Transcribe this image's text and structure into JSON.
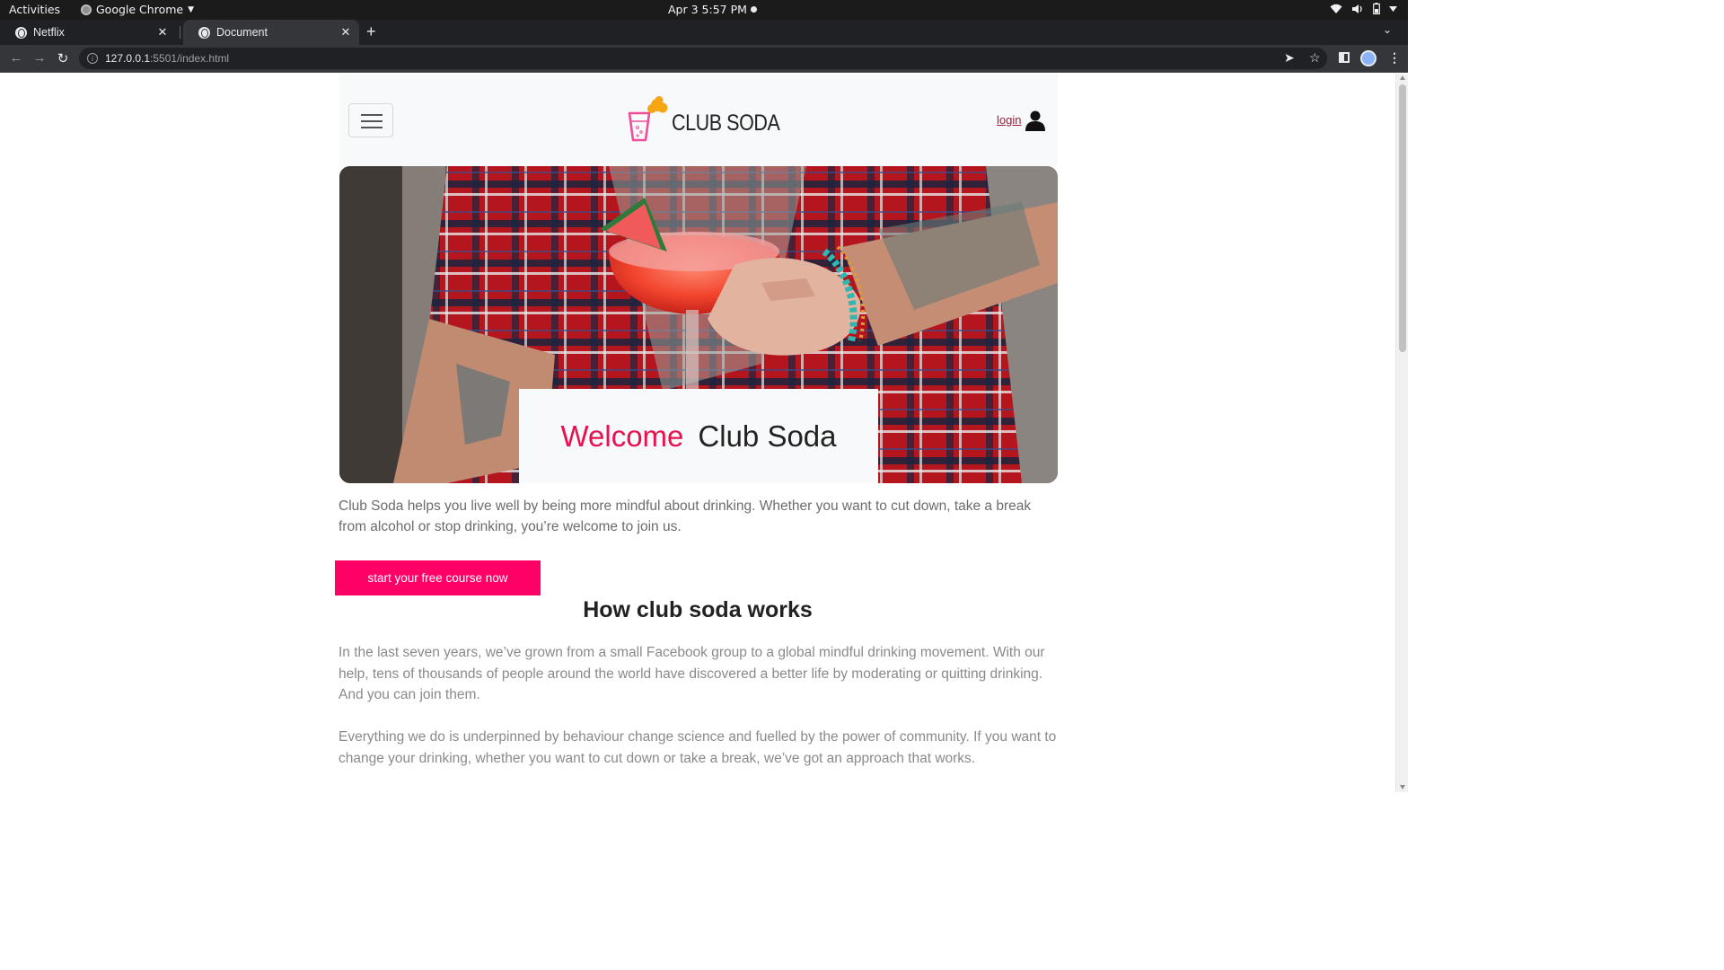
{
  "system_bar": {
    "activities": "Activities",
    "app_name": "Google Chrome",
    "clock": "Apr 3  5:57 PM"
  },
  "browser": {
    "tabs": [
      {
        "label": "Netflix",
        "active": false
      },
      {
        "label": "Document",
        "active": true
      }
    ],
    "url_host": "127.0.0.1",
    "url_path": ":5501/index.html"
  },
  "site": {
    "logo_text": "CLUB SODA",
    "login_label": "login",
    "hero": {
      "welcome_accent": "Welcome",
      "welcome_name": "Club Soda"
    },
    "intro": "Club Soda helps you live well by being more mindful about drinking. Whether you want to cut down, take a break from alcohol or stop drinking, you’re welcome to join us.",
    "cta_label": "start your free course now",
    "section_title": "How club soda works",
    "paragraphs": [
      "In the last seven years, we’ve grown from a small Facebook group to a global mindful drinking movement. With our help, tens of thousands of people around the world have discovered a better life by moderating or quitting drinking. And you can join them.",
      "Everything we do is underpinned by behaviour change science and fuelled by the power of community. If you want to change your drinking, whether you want to cut down or take a break, we’ve got an approach that works."
    ]
  },
  "colors": {
    "accent_pink": "#ff0066",
    "welcome_red": "#e8104f",
    "login_link": "#a01e3a"
  }
}
